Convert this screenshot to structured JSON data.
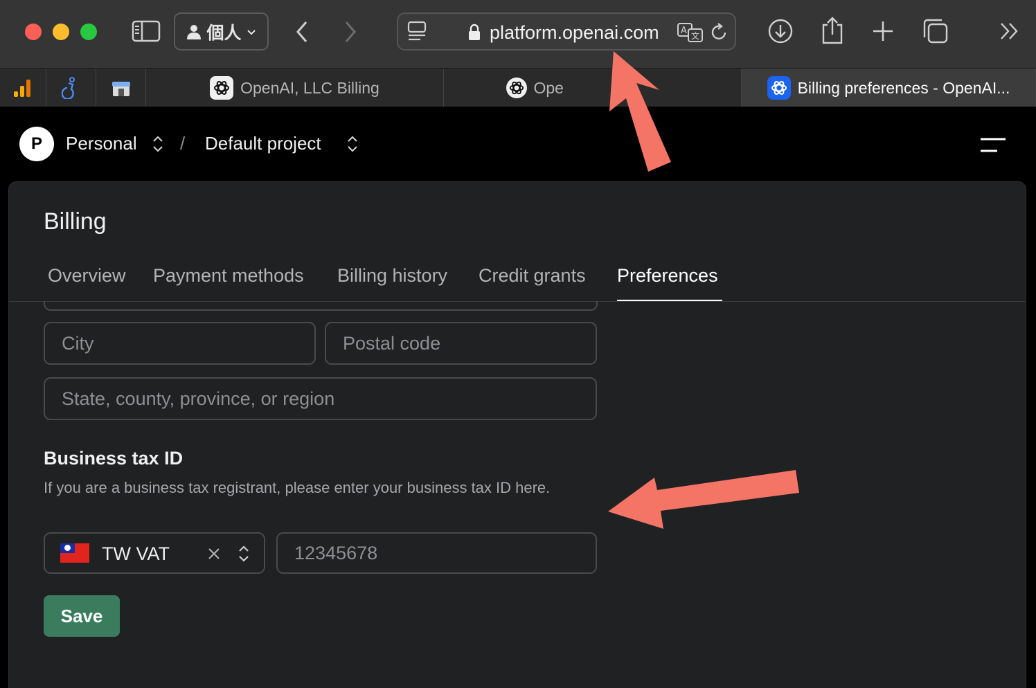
{
  "browser": {
    "profile_label": "個人",
    "url": "platform.openai.com",
    "tabs": [
      {
        "label": "OpenAI, LLC Billing"
      },
      {
        "label": "Ope"
      },
      {
        "label": "Billing preferences - OpenAI..."
      }
    ]
  },
  "header": {
    "avatar_letter": "P",
    "org": "Personal",
    "separator": "/",
    "project": "Default project"
  },
  "page": {
    "title": "Billing",
    "tabs": [
      {
        "label": "Overview"
      },
      {
        "label": "Payment methods"
      },
      {
        "label": "Billing history"
      },
      {
        "label": "Credit grants"
      },
      {
        "label": "Preferences"
      }
    ],
    "active_tab": "Preferences"
  },
  "form": {
    "city_placeholder": "City",
    "postal_placeholder": "Postal code",
    "state_placeholder": "State, county, province, or region",
    "tax_section_title": "Business tax ID",
    "tax_description": "If you are a business tax registrant, please enter your business tax ID here.",
    "tax_type": "TW VAT",
    "tax_id_placeholder": "12345678",
    "save_label": "Save"
  },
  "colors": {
    "accent_save": "#3b7c5f",
    "annotation_arrow": "#f47566",
    "panel_bg": "#202123"
  }
}
